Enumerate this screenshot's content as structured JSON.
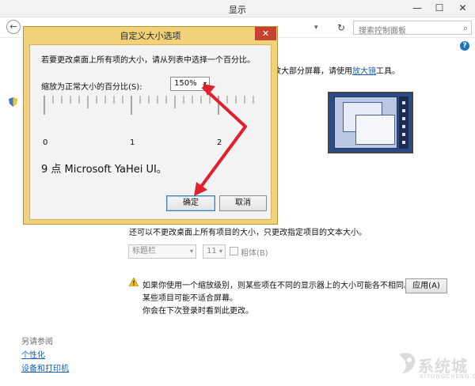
{
  "window": {
    "title": "显示",
    "minimize_glyph": "—",
    "maximize_glyph": "☐",
    "close_glyph": "✕"
  },
  "address": {
    "search_placeholder": "搜索控制面板"
  },
  "main": {
    "text_line1": "放大部分屏幕，请使用",
    "magnifier_link": "放大镜",
    "text_line1_tail": "工具。",
    "text_only_line": "还可以不更改桌面上所有项目的大小，只更改指定项目的文本大小。",
    "item_select": "标题栏",
    "size_select": "11",
    "bold_label": "粗体(B)",
    "warning_line1": "如果你使用一个缩放级别，则某些项在不同的显示器上的大小可能各不相同。",
    "warning_line2": "某些项目可能不适合屏幕。",
    "warning_line3": "你会在下次登录时看到此更改。",
    "apply_label": "应用(A)"
  },
  "see_also": {
    "title": "另请参阅",
    "links": [
      "个性化",
      "设备和打印机"
    ]
  },
  "dialog": {
    "title": "自定义大小选项",
    "close_glyph": "✕",
    "instruction": "若要更改桌面上所有项的大小，请从列表中选择一个百分比。",
    "scale_label": "缩放为正常大小的百分比(S):",
    "scale_value": "150%",
    "ruler_labels": [
      "0",
      "1",
      "2"
    ],
    "preview_text": "9 点 Microsoft YaHei UI。",
    "ok_label": "确定",
    "cancel_label": "取消"
  },
  "watermark": {
    "text": "系统城",
    "url": "XITONGCHENG.COM"
  },
  "colors": {
    "dialog_frame": "#f1d27a",
    "close_red": "#c7432f",
    "link_blue": "#1461b8",
    "annotation_red": "#e0202a"
  }
}
